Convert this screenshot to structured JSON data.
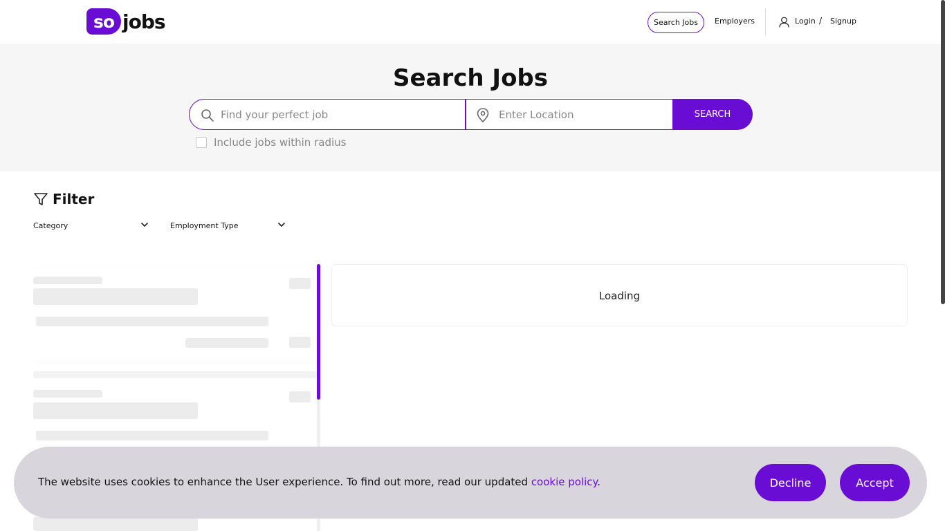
{
  "header": {
    "logo_so": "so",
    "logo_jobs": "jobs",
    "nav": {
      "search_jobs": "Search Jobs",
      "employers": "Employers",
      "login": "Login",
      "slash": "/",
      "signup": "Signup"
    }
  },
  "hero": {
    "title": "Search Jobs",
    "job_placeholder": "Find your perfect job",
    "location_placeholder": "Enter Location",
    "search_button": "SEARCH",
    "radius_label": "Include jobs within radius"
  },
  "filter": {
    "title": "Filter",
    "dropdowns": [
      "Category",
      "Employment Type"
    ]
  },
  "detail": {
    "loading_text": "Loading"
  },
  "cookie": {
    "text": "The website uses cookies to enhance the User experience. To find out more, read our updated ",
    "link": "cookie policy",
    "period": ".",
    "decline": "Decline",
    "accept": "Accept"
  },
  "colors": {
    "brand": "#6a0dd4",
    "hero_bg": "#f6f6f6",
    "cookie_bg": "#d8d6dc",
    "skeleton": "#ececec"
  }
}
